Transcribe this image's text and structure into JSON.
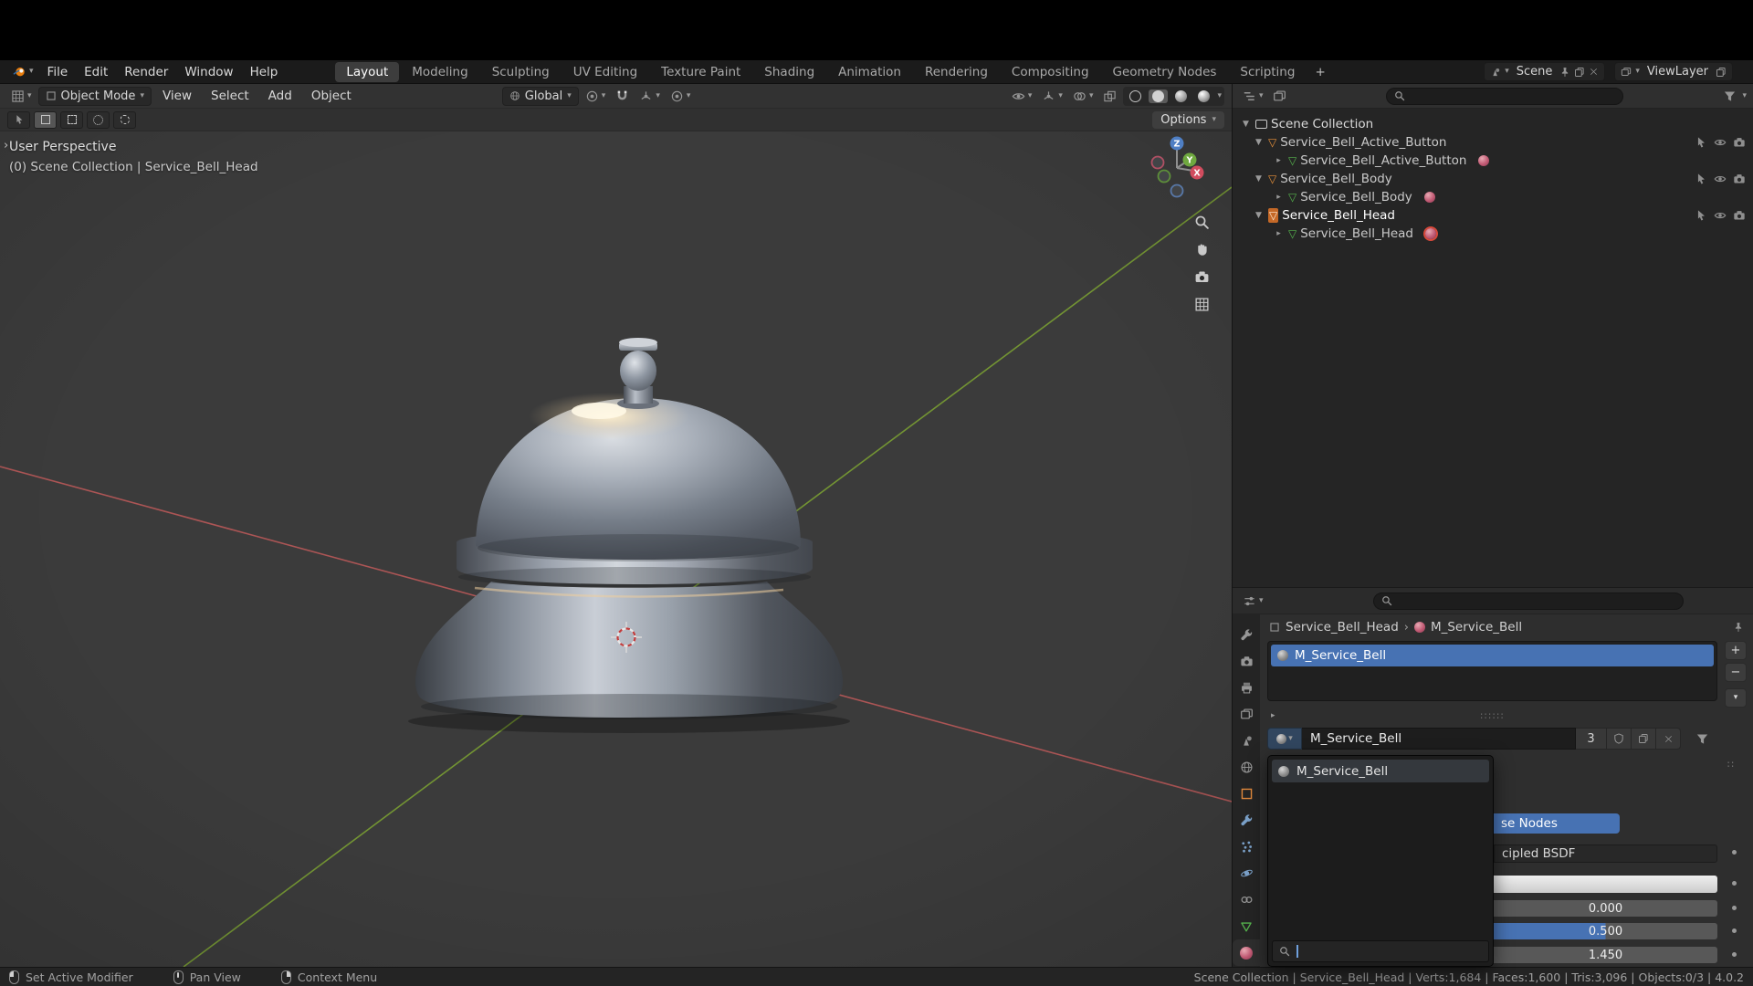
{
  "glyphs": {
    "chevron_down": "▾",
    "disclosure_open": "▼",
    "disclosure_closed": "▸",
    "toolbar_expand": "›",
    "plus": "+",
    "minus": "−",
    "close": "✕",
    "grip_dots": "∷∷∷",
    "panel_grip": "∷",
    "mesh_triangle": "▽",
    "breadcrumb_separator": "›",
    "add_workspace": "+"
  },
  "topbar": {
    "menus": [
      {
        "label": "File"
      },
      {
        "label": "Edit"
      },
      {
        "label": "Render"
      },
      {
        "label": "Window"
      },
      {
        "label": "Help"
      }
    ],
    "workspaces": [
      {
        "label": "Layout"
      },
      {
        "label": "Modeling"
      },
      {
        "label": "Sculpting"
      },
      {
        "label": "UV Editing"
      },
      {
        "label": "Texture Paint"
      },
      {
        "label": "Shading"
      },
      {
        "label": "Animation"
      },
      {
        "label": "Rendering"
      },
      {
        "label": "Compositing"
      },
      {
        "label": "Geometry Nodes"
      },
      {
        "label": "Scripting"
      }
    ],
    "scene_selector": {
      "label": "Scene"
    },
    "viewlayer_selector": {
      "label": "ViewLayer"
    }
  },
  "viewport": {
    "header": {
      "mode": "Object Mode",
      "menus": [
        {
          "label": "View"
        },
        {
          "label": "Select"
        },
        {
          "label": "Add"
        },
        {
          "label": "Object"
        }
      ],
      "orientation": "Global",
      "options": "Options"
    },
    "overlay": {
      "view_label": "User Perspective",
      "context_label": "(0) Scene Collection | Service_Bell_Head"
    },
    "axis_gizmo": {
      "x": "X",
      "y": "Y",
      "z": "Z"
    }
  },
  "outliner": {
    "root_label": "Scene Collection",
    "items": [
      {
        "label": "Service_Bell_Active_Button"
      },
      {
        "label": "Service_Bell_Active_Button"
      },
      {
        "label": "Service_Bell_Body"
      },
      {
        "label": "Service_Bell_Body"
      },
      {
        "label": "Service_Bell_Head"
      },
      {
        "label": "Service_Bell_Head"
      }
    ]
  },
  "properties": {
    "breadcrumb": {
      "object": "Service_Bell_Head",
      "material": "M_Service_Bell"
    },
    "slots": [
      {
        "name": "M_Service_Bell"
      }
    ],
    "material_field": {
      "name": "M_Service_Bell",
      "users": "3"
    },
    "browser": {
      "items": [
        {
          "name": "M_Service_Bell"
        }
      ]
    },
    "use_nodes_label": "se Nodes",
    "surface_label": "cipled BSDF",
    "values": [
      {
        "text": "0.000"
      },
      {
        "text": "0.500"
      },
      {
        "text": "1.450"
      }
    ]
  },
  "statusbar": {
    "hints": [
      {
        "label": "Set Active Modifier"
      },
      {
        "label": "Pan View"
      },
      {
        "label": "Context Menu"
      }
    ],
    "info": "Scene Collection | Service_Bell_Head | Verts:1,684 | Faces:1,600 | Tris:3,096 | Objects:0/3 | 4.0.2"
  },
  "colors": {
    "accent": "#4772b3",
    "object_orange": "#e8913a",
    "data_green": "#55b24c",
    "material_pink": "#c15a74",
    "axis_x": "#c05a5a",
    "axis_y": "#7da432",
    "axis_z": "#4f7fc4"
  }
}
